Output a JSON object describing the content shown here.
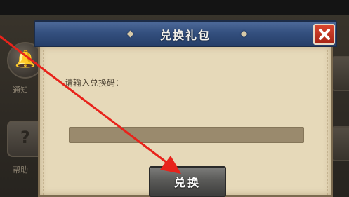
{
  "background": {
    "side_buttons": [
      {
        "icon": "bell-icon",
        "label": "通知"
      },
      {
        "icon": "question-icon",
        "label": "帮助"
      }
    ]
  },
  "dialog": {
    "title": "兑换礼包",
    "close_icon": "close-icon",
    "prompt": "请输入兑换码：",
    "code_input": {
      "value": "",
      "placeholder": ""
    },
    "redeem_label": "兑换"
  },
  "colors": {
    "header_blue": "#34507f",
    "parchment": "#e6d9b9",
    "close_red": "#c23a25",
    "arrow_red": "#e8231b"
  }
}
